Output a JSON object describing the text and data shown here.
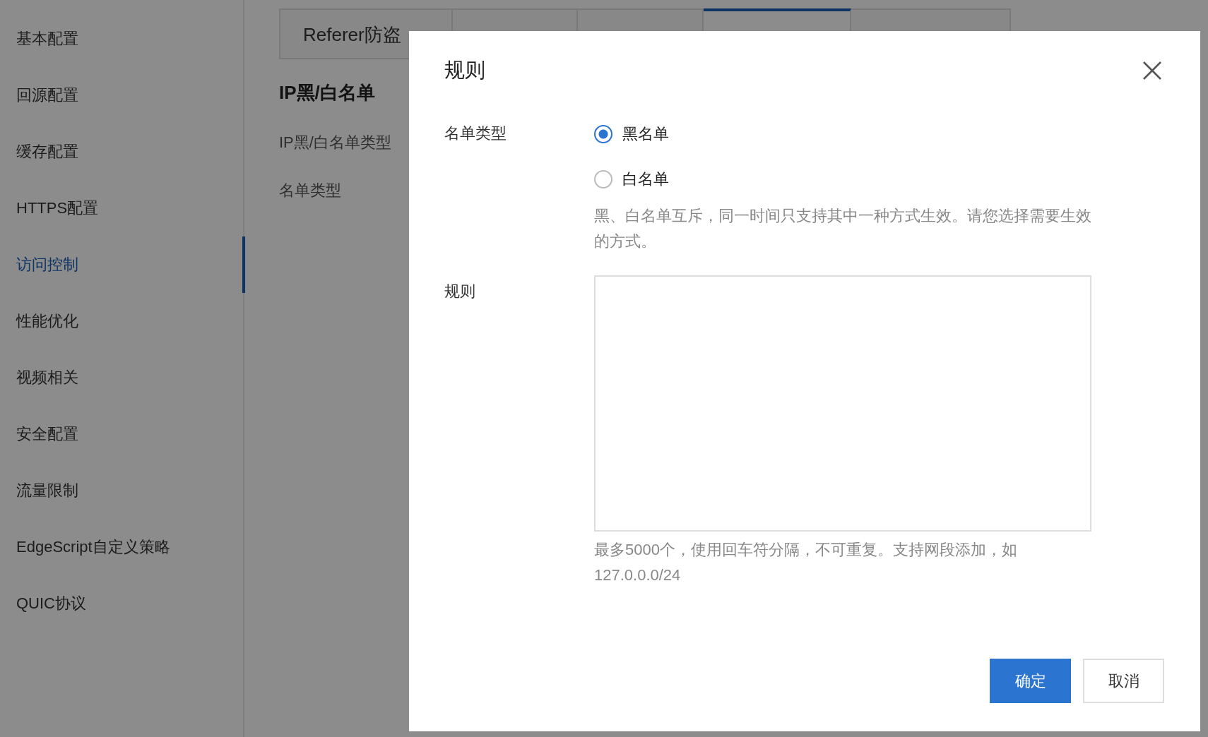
{
  "sidebar": {
    "items": [
      {
        "label": "基本配置",
        "selected": false
      },
      {
        "label": "回源配置",
        "selected": false
      },
      {
        "label": "缓存配置",
        "selected": false
      },
      {
        "label": "HTTPS配置",
        "selected": false
      },
      {
        "label": "访问控制",
        "selected": true
      },
      {
        "label": "性能优化",
        "selected": false
      },
      {
        "label": "视频相关",
        "selected": false
      },
      {
        "label": "安全配置",
        "selected": false
      },
      {
        "label": "流量限制",
        "selected": false
      },
      {
        "label": "EdgeScript自定义策略",
        "selected": false
      },
      {
        "label": "QUIC协议",
        "selected": false
      }
    ]
  },
  "tabs": [
    {
      "label": "Referer防盗",
      "selected": false
    },
    {
      "selected": false
    },
    {
      "selected": false
    },
    {
      "selected": true
    },
    {
      "selected": false
    }
  ],
  "section": {
    "title": "IP黑/白名单",
    "fields": [
      {
        "label": "IP黑/白名单类型"
      },
      {
        "label": "名单类型"
      }
    ]
  },
  "dialog": {
    "title": "规则",
    "list_type": {
      "label": "名单类型",
      "options": [
        {
          "label": "黑名单",
          "selected": true
        },
        {
          "label": "白名单",
          "selected": false
        }
      ],
      "hint": "黑、白名单互斥，同一时间只支持其中一种方式生效。请您选择需要生效的方式。"
    },
    "rules": {
      "label": "规则",
      "hint": "最多5000个，使用回车符分隔，不可重复。支持网段添加，如127.0.0.0/24"
    },
    "buttons": [
      {
        "label": "确定",
        "kind": "primary"
      },
      {
        "label": "取消",
        "kind": "default"
      }
    ]
  }
}
